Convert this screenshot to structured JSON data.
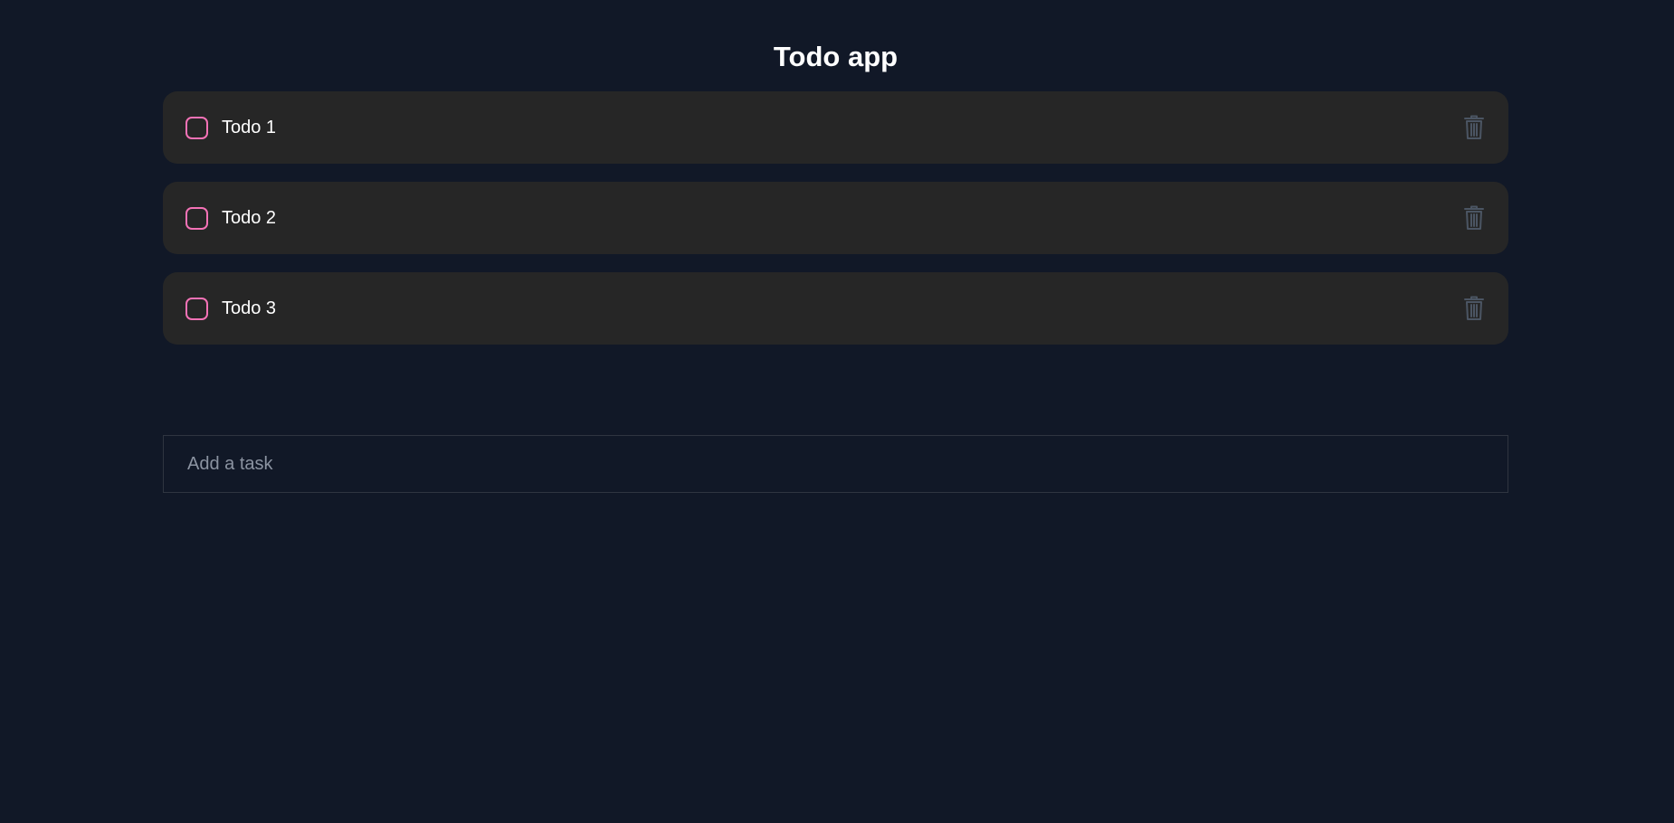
{
  "app": {
    "title": "Todo app"
  },
  "todos": [
    {
      "label": "Todo 1",
      "completed": false
    },
    {
      "label": "Todo 2",
      "completed": false
    },
    {
      "label": "Todo 3",
      "completed": false
    }
  ],
  "add_task": {
    "value": "",
    "placeholder": "Add a task"
  },
  "icons": {
    "checkbox": "checkbox-icon",
    "delete": "trash-icon"
  },
  "colors": {
    "background": "#111827",
    "card": "#262626",
    "checkbox_border": "#f472b6",
    "trash": "#4b5563",
    "input_border": "#2f3540",
    "placeholder": "#8b93a1"
  }
}
